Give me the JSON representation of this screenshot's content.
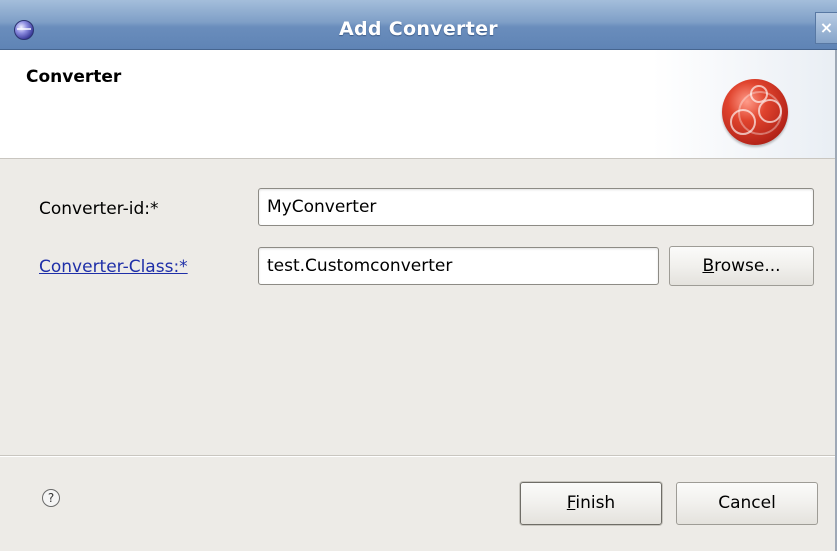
{
  "window": {
    "title": "Add Converter",
    "close_glyph": "×"
  },
  "banner": {
    "title": "Converter",
    "icon": "red-sphere-wizard-icon"
  },
  "form": {
    "converter_id": {
      "label": "Converter-id:*",
      "value": "MyConverter"
    },
    "converter_class": {
      "label": "Converter-Class:*",
      "value": "test.Customconverter"
    },
    "browse_button": {
      "label_mnemonic": "B",
      "label_rest": "rowse..."
    }
  },
  "footer": {
    "help_glyph": "?",
    "finish_button": {
      "label_mnemonic": "F",
      "label_rest": "inish"
    },
    "cancel_button": {
      "label": "Cancel"
    }
  },
  "colors": {
    "titlebar": "#7f9fc7",
    "link": "#1f2fa8",
    "dialog_bg": "#edebe7"
  }
}
